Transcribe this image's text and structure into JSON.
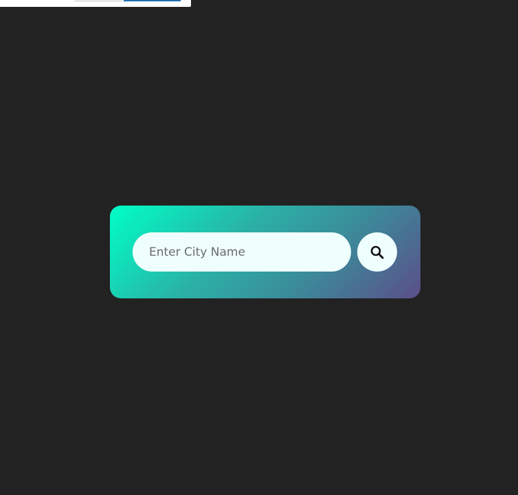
{
  "search": {
    "placeholder": "Enter City Name",
    "value": "",
    "button_icon": "search-icon"
  },
  "colors": {
    "background": "#222222",
    "card_gradient_start": "#00ffc6",
    "card_gradient_end": "#5b4f8a",
    "input_background": "#effffd"
  }
}
